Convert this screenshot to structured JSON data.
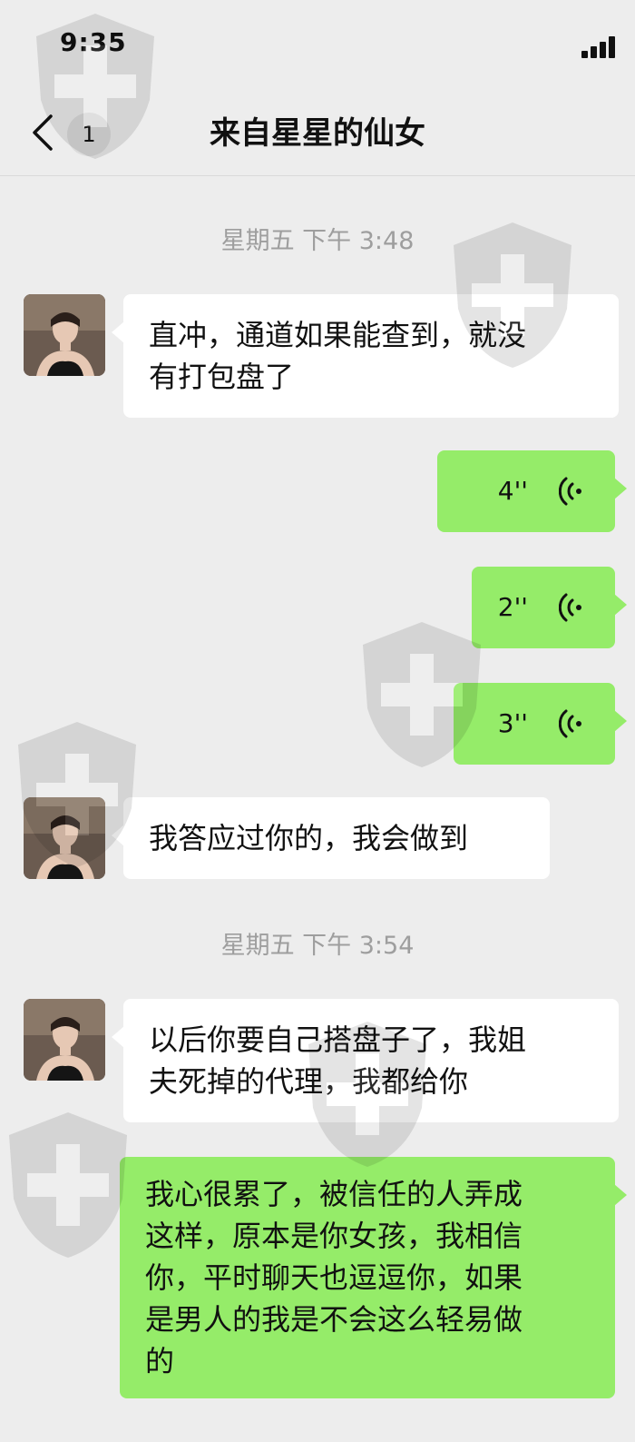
{
  "status_bar": {
    "time": "9:35"
  },
  "nav": {
    "back_icon": "chevron-left-icon",
    "unread_count": "1",
    "title": "来自星星的仙女"
  },
  "messages": [
    {
      "type": "timestamp",
      "text": "星期五 下午 3:48"
    },
    {
      "type": "text",
      "direction": "in",
      "text_lines": [
        "直冲，通道如果能查到，就没",
        "有打包盘了"
      ]
    },
    {
      "type": "voice",
      "direction": "out",
      "duration": "4''"
    },
    {
      "type": "voice",
      "direction": "out",
      "duration": "2''"
    },
    {
      "type": "voice",
      "direction": "out",
      "duration": "3''"
    },
    {
      "type": "text",
      "direction": "in",
      "text_lines": [
        "我答应过你的，我会做到"
      ]
    },
    {
      "type": "timestamp",
      "text": "星期五 下午 3:54"
    },
    {
      "type": "text",
      "direction": "in",
      "text_lines": [
        "以后你要自己搭盘子了，我姐",
        "夫死掉的代理，我都给你"
      ]
    },
    {
      "type": "text",
      "direction": "out",
      "text_lines": [
        "我心很累了，被信任的人弄成",
        "这样，原本是你女孩，我相信",
        "你，平时聊天也逗逗你，如果",
        "是男人的我是不会这么轻易做",
        "的"
      ]
    }
  ],
  "colors": {
    "background": "#ededed",
    "incoming_bubble": "#ffffff",
    "outgoing_bubble": "#95ec69",
    "timestamp": "#9e9e9e"
  },
  "icons": [
    "chevron-left-icon",
    "signal-icon",
    "voice-wave-icon"
  ]
}
